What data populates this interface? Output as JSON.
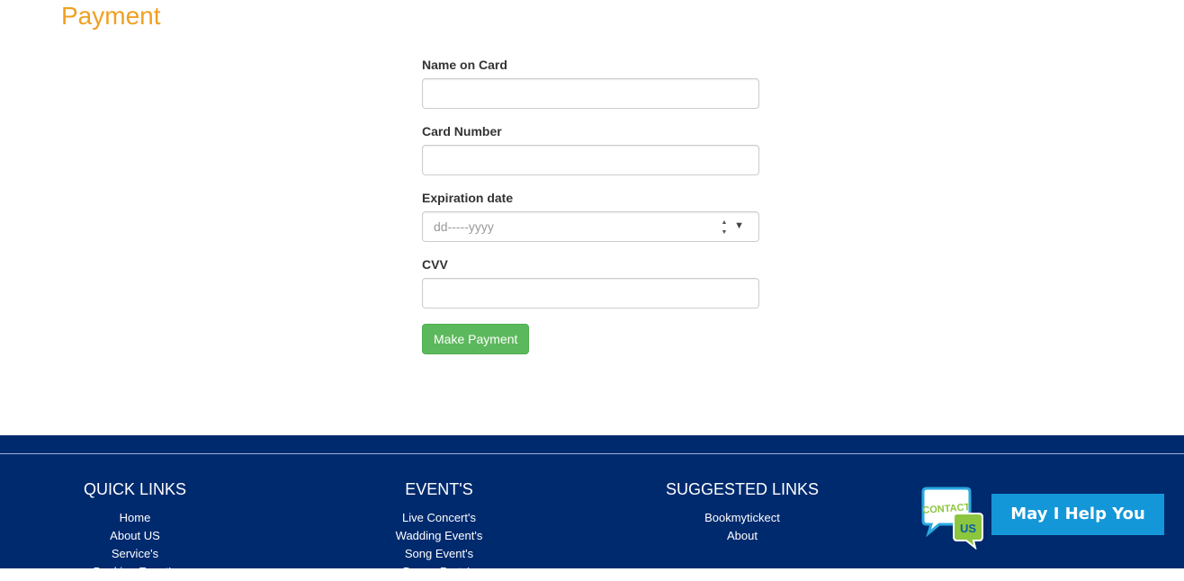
{
  "page": {
    "title": "Payment"
  },
  "form": {
    "name_label": "Name on Card",
    "name_value": "",
    "card_label": "Card Number",
    "card_value": "",
    "expiry_label": "Expiration date",
    "expiry_placeholder": "dd-----yyyy",
    "cvv_label": "CVV",
    "cvv_value": "",
    "submit_label": "Make Payment"
  },
  "footer": {
    "quick_links": {
      "title": "QUICK LINKS",
      "items": [
        "Home",
        "About US",
        "Service's",
        "Booking Event's"
      ]
    },
    "events": {
      "title": "EVENT'S",
      "items": [
        "Live Concert's",
        "Wadding Event's",
        "Song Event's",
        "Dance Party's"
      ]
    },
    "suggested": {
      "title": "SUGGESTED LINKS",
      "items": [
        "Bookmytickect",
        "About"
      ]
    }
  },
  "chat": {
    "badge_line1": "CONTACT",
    "badge_line2": "US",
    "help_label": "May I Help You"
  },
  "colors": {
    "title": "#f0a023",
    "button": "#5cb85c",
    "footer_bg": "#002a6e",
    "help_bg": "#1497d8"
  },
  "icons": [
    "spinner-icon",
    "dropdown-arrow-icon",
    "contact-us-icon"
  ]
}
